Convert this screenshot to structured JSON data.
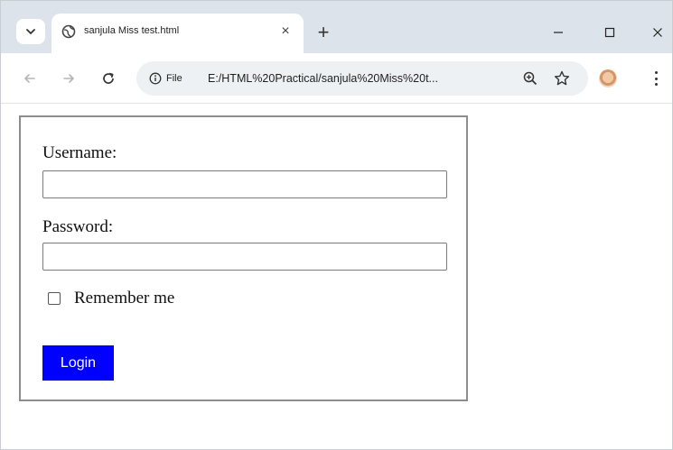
{
  "browser": {
    "tab": {
      "title": "sanjula Miss test.html",
      "close_glyph": "×"
    },
    "new_tab_glyph": "+",
    "omnibox": {
      "chip_label": "File",
      "url": "E:/HTML%20Practical/sanjula%20Miss%20t..."
    },
    "icons": {
      "tab_search": "chevron-down-icon",
      "favicon": "globe-icon",
      "back": "arrow-left-icon",
      "forward": "arrow-right-icon",
      "reload": "reload-icon",
      "info": "info-icon",
      "zoom": "zoom-icon",
      "bookmark": "star-icon",
      "profile": "avatar",
      "menu": "kebab-menu-icon",
      "minimize": "minimize-icon",
      "maximize": "maximize-icon",
      "close": "close-icon"
    }
  },
  "form": {
    "username_label": "Username:",
    "username_value": "",
    "password_label": "Password:",
    "password_value": "",
    "remember_label": "Remember me",
    "remember_checked": false,
    "login_label": "Login",
    "login_color": "#0000ff"
  }
}
